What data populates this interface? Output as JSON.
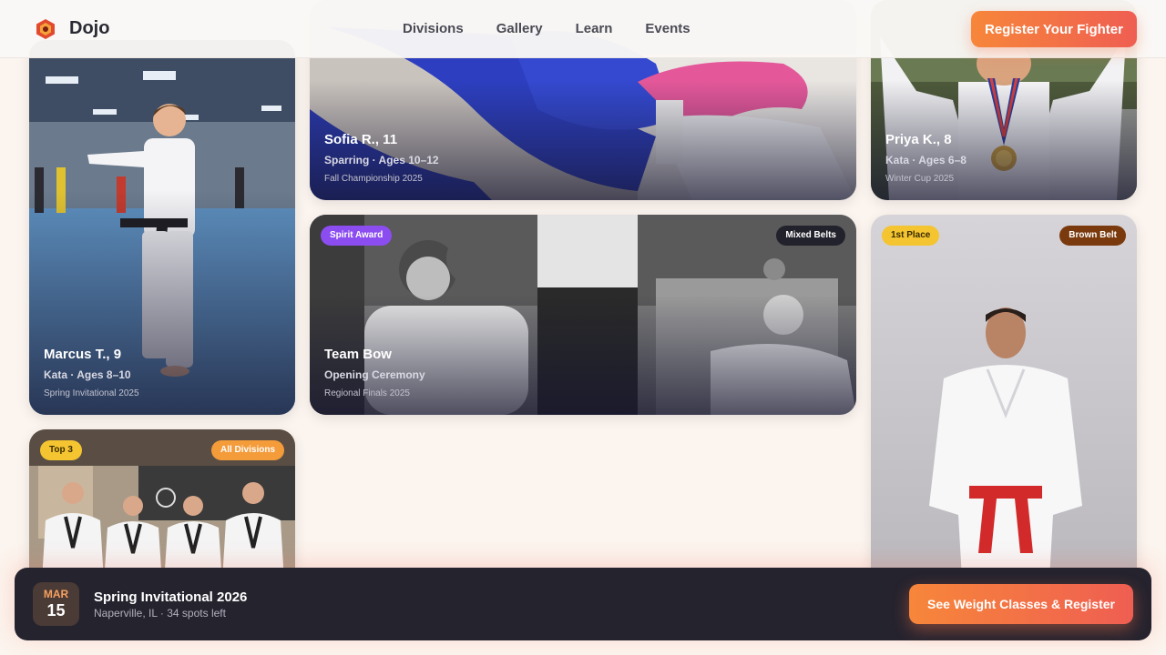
{
  "header": {
    "brand": "Dojo",
    "nav": [
      "Divisions",
      "Gallery",
      "Learn",
      "Events"
    ],
    "cta": "Register Your Fighter"
  },
  "cards": [
    {
      "name": "Marcus T., 9",
      "division": "Kata · Ages 8–10",
      "event": "Spring Invitational 2025"
    },
    {
      "name": "Sofia R., 11",
      "division": "Sparring · Ages 10–12",
      "event": "Fall Championship 2025"
    },
    {
      "name": "Priya K., 8",
      "division": "Kata · Ages 6–8",
      "event": "Winter Cup 2025"
    },
    {
      "name": "Team Bow",
      "division": "Opening Ceremony",
      "event": "Regional Finals 2025",
      "badges": [
        "Spirit Award",
        "Mixed Belts"
      ]
    },
    {
      "badges": [
        "Top 3",
        "All Divisions"
      ]
    },
    {
      "badges": [
        "1st Place",
        "Brown Belt"
      ]
    }
  ],
  "event_bar": {
    "month": "MAR",
    "day": "15",
    "title": "Spring Invitational 2026",
    "subtitle": "Naperville, IL · 34 spots left",
    "cta": "See Weight Classes & Register"
  },
  "colors": {
    "accent_start": "#f7863a",
    "accent_end": "#ef5e52",
    "bar_bg": "#25232e"
  }
}
